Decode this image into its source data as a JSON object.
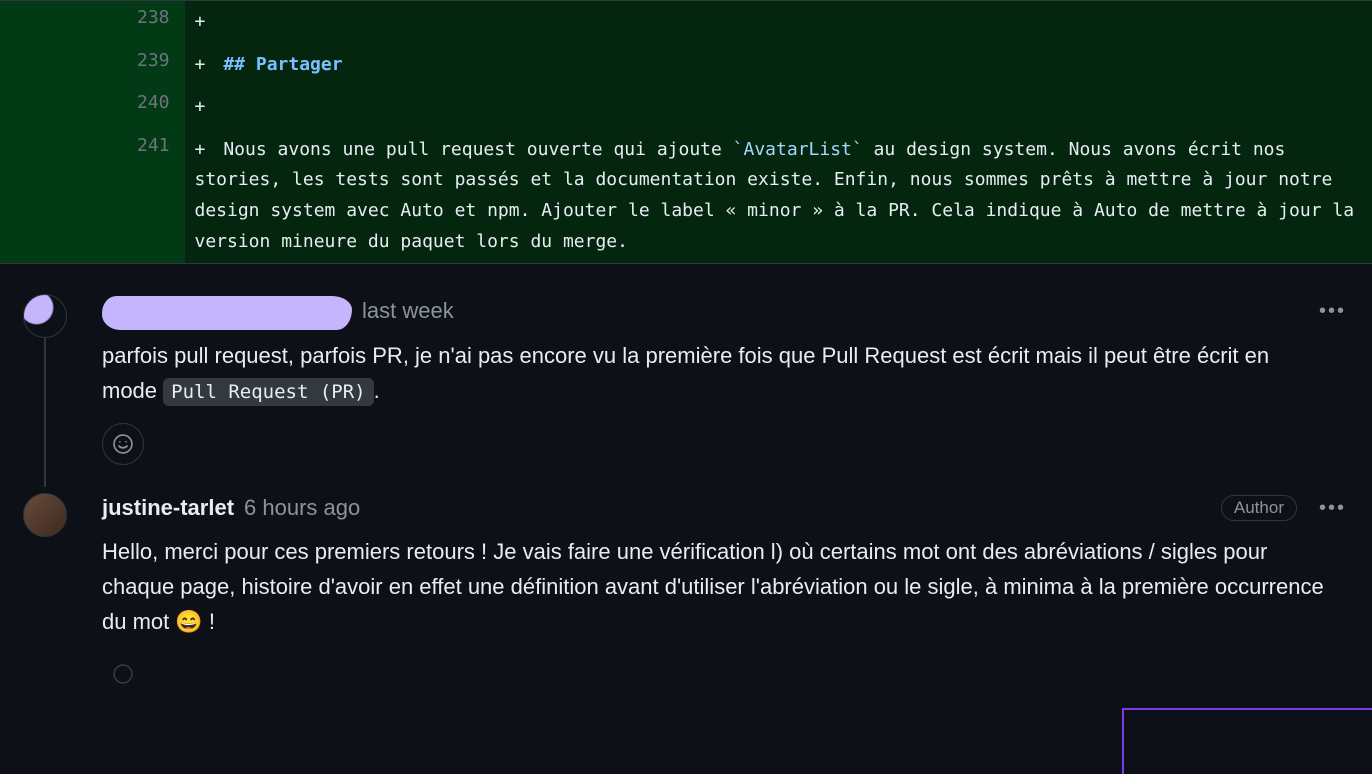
{
  "diff": {
    "lines": [
      {
        "num": "238",
        "plus": "+",
        "content": ""
      },
      {
        "num": "239",
        "plus": "+",
        "pre": " ",
        "heading": "## Partager"
      },
      {
        "num": "240",
        "plus": "+",
        "content": ""
      },
      {
        "num": "241",
        "plus": "+",
        "text_pre": " Nous avons une pull request ouverte qui ajoute ",
        "code": "`AvatarList`",
        "text_post": " au design system. Nous avons écrit nos stories, les tests sont passés et la documentation existe. Enfin, nous sommes prêts à mettre à jour notre design system avec Auto et npm. Ajouter le label « minor » à la PR. Cela indique à Auto de mettre à jour la version mineure du paquet lors du merge."
      }
    ]
  },
  "comments": [
    {
      "author_redacted": true,
      "timestamp": "last week",
      "body_pre": "parfois pull request, parfois PR, je n'ai pas encore vu la première fois que Pull Request est écrit mais il peut être écrit en mode ",
      "body_code": "Pull Request (PR)",
      "body_post": "."
    },
    {
      "author": "justine-tarlet",
      "timestamp": "6 hours ago",
      "badge": "Author",
      "body": "Hello, merci pour ces premiers retours ! Je vais faire une vérification l) où certains mot ont des abréviations / sigles pour chaque page, histoire d'avoir en effet une définition avant d'utiliser l'abréviation ou le sigle, à minima à la première occurrence du mot 😄 !"
    }
  ]
}
